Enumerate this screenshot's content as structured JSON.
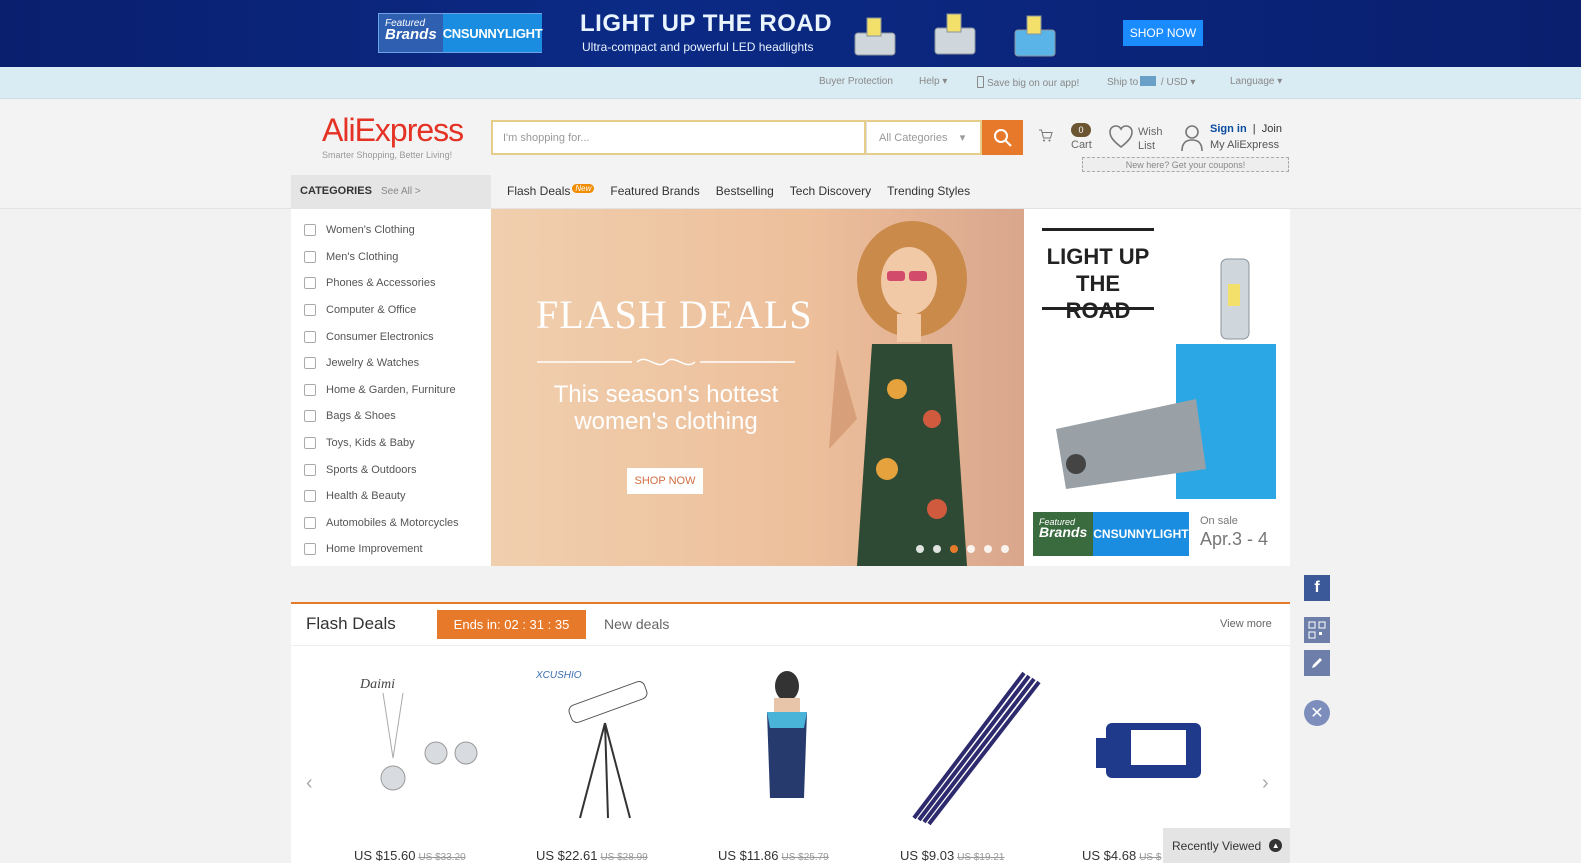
{
  "top_banner": {
    "featured_small": "Featured",
    "featured_big": "Brands",
    "brand": "CNSUNNYLIGHT",
    "title": "LIGHT UP THE ROAD",
    "subtitle": "Ultra-compact and powerful  LED headlights",
    "cta": "SHOP NOW"
  },
  "util_bar": {
    "buyer_protection": "Buyer Protection",
    "help": "Help",
    "app": "Save big on our app!",
    "ship_to": "Ship to",
    "currency": "USD",
    "language": "Language"
  },
  "header": {
    "logo": "AliExpress",
    "tagline": "Smarter Shopping, Better Living!",
    "search_placeholder": "I'm shopping for...",
    "category_select": "All Categories",
    "cart_count": "0",
    "cart_label": "Cart",
    "wish_line1": "Wish",
    "wish_line2": "List",
    "sign_in": "Sign in",
    "join": "Join",
    "my_aliexpress": "My AliExpress",
    "coupon_text": "New here? Get your coupons!"
  },
  "nav": {
    "categories_label": "CATEGORIES",
    "see_all": "See All >",
    "tabs": [
      {
        "label": "Flash Deals",
        "badge": "New"
      },
      {
        "label": "Featured Brands"
      },
      {
        "label": "Bestselling"
      },
      {
        "label": "Tech Discovery"
      },
      {
        "label": "Trending Styles"
      }
    ]
  },
  "categories": [
    "Women's Clothing",
    "Men's Clothing",
    "Phones & Accessories",
    "Computer & Office",
    "Consumer Electronics",
    "Jewelry & Watches",
    "Home & Garden, Furniture",
    "Bags & Shoes",
    "Toys, Kids & Baby",
    "Sports & Outdoors",
    "Health & Beauty",
    "Automobiles & Motorcycles",
    "Home Improvement"
  ],
  "hero": {
    "title": "FLASH DEALS",
    "subtitle_1": "This season's hottest",
    "subtitle_2": "women's clothing",
    "cta": "SHOP NOW",
    "slides": 6,
    "active_slide": 3
  },
  "side_promo": {
    "title_1": "LIGHT UP",
    "title_2": "THE ROAD",
    "featured_small": "Featured",
    "featured_big": "Brands",
    "brand": "CNSUNNYLIGHT",
    "on_sale": "On sale",
    "date": "Apr.3 - 4"
  },
  "flash_deals": {
    "title": "Flash Deals",
    "timer": "Ends in: 02 : 31 : 35",
    "new_deals": "New deals",
    "view_more": "View more",
    "products": [
      {
        "price": "US $15.60",
        "old_price": "US $33.20"
      },
      {
        "price": "US $22.61",
        "old_price": "US $28.99"
      },
      {
        "price": "US $11.86",
        "old_price": "US $25.79"
      },
      {
        "price": "US $9.03",
        "old_price": "US $19.21"
      },
      {
        "price": "US $4.68",
        "old_price": "US $"
      }
    ]
  },
  "recently_viewed": "Recently Viewed",
  "colors": {
    "accent": "#e77a2a",
    "brand_red": "#e43225",
    "banner_blue": "#0b2a85",
    "link_blue": "#0a4aa0"
  }
}
